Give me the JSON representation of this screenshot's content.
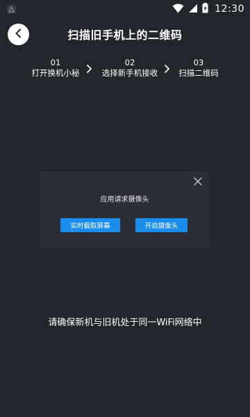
{
  "status_bar": {
    "time": "12:30",
    "icons": [
      "notification-icon",
      "wifi-icon",
      "signal-icon",
      "battery-charging-icon"
    ]
  },
  "header": {
    "back_icon": "chevron-left-icon",
    "title": "扫描旧手机上的二维码"
  },
  "steps": [
    {
      "number": "01",
      "label": "打开换机小秘"
    },
    {
      "number": "02",
      "label": "选择新手机接收"
    },
    {
      "number": "03",
      "label": "扫描二维码"
    }
  ],
  "dialog": {
    "message": "应用请求摄像头",
    "close_icon": "close-icon",
    "screenshot_button": "实时截取屏幕",
    "camera_button": "开启摄像头",
    "accent_color": "#1a8ceb"
  },
  "bottom_hint": "请确保新机与旧机处于同一WiFi网络中",
  "colors": {
    "background": "#22252c",
    "dialog_background": "#2b2d38"
  }
}
